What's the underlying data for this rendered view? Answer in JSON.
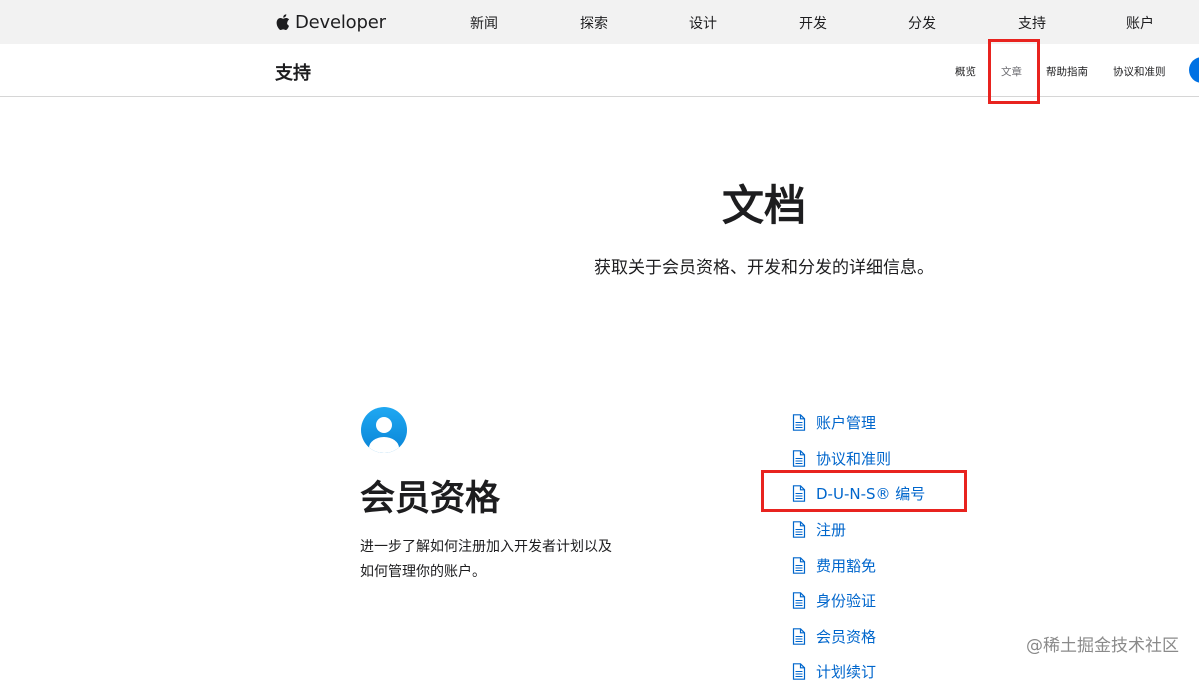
{
  "global_nav": {
    "brand": "Developer",
    "items": [
      "新闻",
      "探索",
      "设计",
      "开发",
      "分发",
      "支持",
      "账户"
    ]
  },
  "local_nav": {
    "title": "支持",
    "items": [
      "概览",
      "文章",
      "帮助指南",
      "协议和准则"
    ],
    "current": "文章"
  },
  "hero": {
    "title": "文档",
    "subtitle": "获取关于会员资格、开发和分发的详细信息。"
  },
  "section": {
    "icon": "person-circle-icon",
    "title": "会员资格",
    "description": "进一步了解如何注册加入开发者计划以及如何管理你的账户。",
    "links": [
      "账户管理",
      "协议和准则",
      "D-U-N-S® 编号",
      "注册",
      "费用豁免",
      "身份验证",
      "会员资格",
      "计划续订"
    ]
  },
  "annotations": {
    "highlight_color": "#e8231f",
    "highlighted": [
      "文章",
      "D-U-N-S® 编号"
    ]
  },
  "colors": {
    "link": "#0066cc",
    "accent": "#0071e3",
    "nav_bg": "#f2f2f2"
  },
  "watermark": "@稀土掘金技术社区"
}
